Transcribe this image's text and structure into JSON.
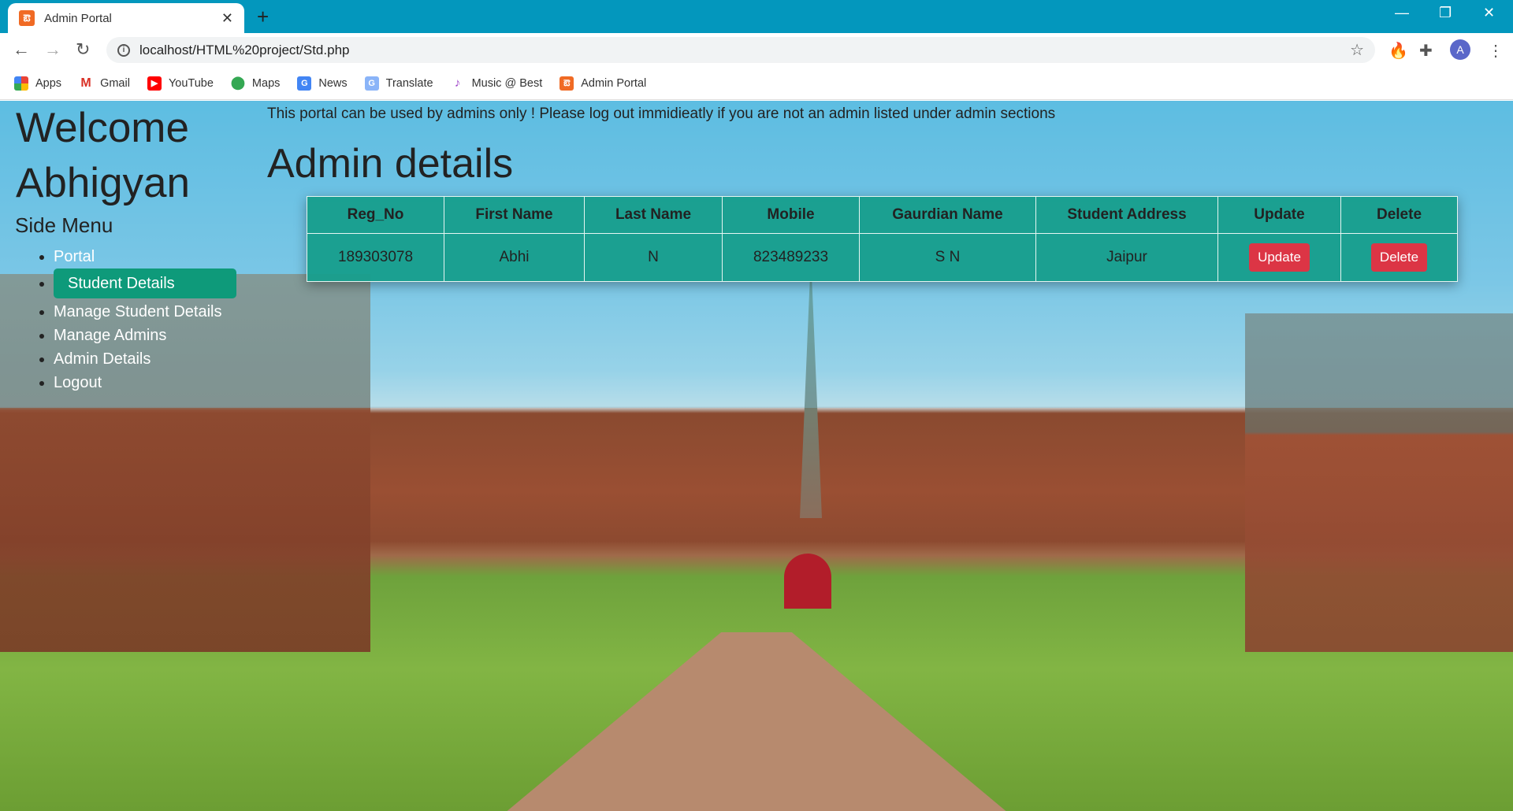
{
  "browser": {
    "tab_title": "Admin Portal",
    "url": "localhost/HTML%20project/Std.php",
    "bookmarks": [
      "Apps",
      "Gmail",
      "YouTube",
      "Maps",
      "News",
      "Translate",
      "Music @ Best",
      "Admin Portal"
    ],
    "avatar_letter": "A"
  },
  "sidebar": {
    "welcome": "Welcome",
    "user": "Abhigyan",
    "title": "Side Menu",
    "items": [
      {
        "label": "Portal"
      },
      {
        "label": "Student Details",
        "active": true
      },
      {
        "label": "Manage Student Details"
      },
      {
        "label": "Manage Admins"
      },
      {
        "label": "Admin Details"
      },
      {
        "label": "Logout"
      }
    ]
  },
  "main": {
    "notice": "This portal can be used by admins only ! Please log out immidieatly if you are not an admin listed under admin sections",
    "heading": "Admin details",
    "table": {
      "headers": [
        "Reg_No",
        "First Name",
        "Last Name",
        "Mobile",
        "Gaurdian Name",
        "Student Address",
        "Update",
        "Delete"
      ],
      "rows": [
        {
          "reg_no": "189303078",
          "first": "Abhi",
          "last": "N",
          "mobile": "823489233",
          "guardian": "S N",
          "address": "Jaipur",
          "update": "Update",
          "delete": "Delete"
        }
      ]
    }
  },
  "colors": {
    "tabbar": "#0397bd",
    "accent": "#0e9a7a",
    "table": "#169e8c",
    "danger": "#dc3545"
  }
}
